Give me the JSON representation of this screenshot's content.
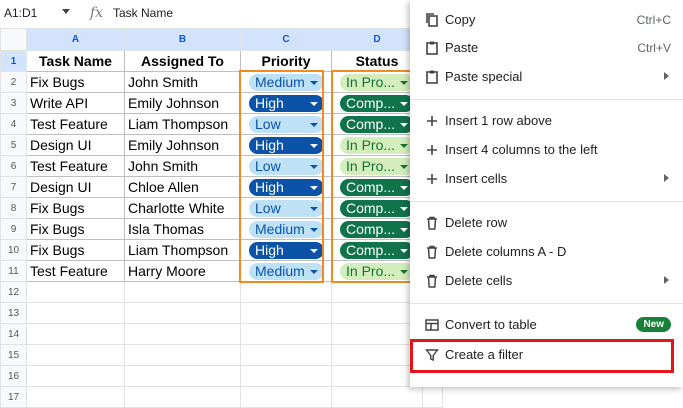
{
  "formula_bar": {
    "name_box": "A1:D1",
    "fx": "fx",
    "content": "Task Name"
  },
  "columns": [
    "A",
    "B",
    "C",
    "D"
  ],
  "row_numbers": [
    "1",
    "2",
    "3",
    "4",
    "5",
    "6",
    "7",
    "8",
    "9",
    "10",
    "11",
    "12",
    "13",
    "14",
    "15",
    "16",
    "17"
  ],
  "headers": [
    "Task Name",
    "Assigned To",
    "Priority",
    "Status"
  ],
  "rows": [
    {
      "task": "Fix Bugs",
      "assigned": "John Smith",
      "priority": "Medium",
      "status": "In Pro..."
    },
    {
      "task": "Write API",
      "assigned": "Emily Johnson",
      "priority": "High",
      "status": "Comp..."
    },
    {
      "task": "Test Feature",
      "assigned": "Liam Thompson",
      "priority": "Low",
      "status": "Comp..."
    },
    {
      "task": "Design UI",
      "assigned": "Emily Johnson",
      "priority": "High",
      "status": "In Pro..."
    },
    {
      "task": "Test Feature",
      "assigned": "John Smith",
      "priority": "Low",
      "status": "In Pro..."
    },
    {
      "task": "Design UI",
      "assigned": "Chloe Allen",
      "priority": "High",
      "status": "Comp..."
    },
    {
      "task": "Fix Bugs",
      "assigned": "Charlotte White",
      "priority": "Low",
      "status": "Comp..."
    },
    {
      "task": "Fix Bugs",
      "assigned": "Isla Thomas",
      "priority": "Medium",
      "status": "Comp..."
    },
    {
      "task": "Fix Bugs",
      "assigned": "Liam Thompson",
      "priority": "High",
      "status": "Comp..."
    },
    {
      "task": "Test Feature",
      "assigned": "Harry Moore",
      "priority": "Medium",
      "status": "In Pro..."
    }
  ],
  "context_menu": {
    "items": [
      {
        "label": "Copy",
        "shortcut": "Ctrl+C",
        "icon": "copy-icon"
      },
      {
        "label": "Paste",
        "shortcut": "Ctrl+V",
        "icon": "paste-icon"
      },
      {
        "label": "Paste special",
        "icon": "paste-special-icon"
      },
      {
        "label": "Insert 1 row above",
        "icon": "plus-icon"
      },
      {
        "label": "Insert 4 columns to the left",
        "icon": "plus-icon"
      },
      {
        "label": "Insert cells",
        "icon": "plus-icon"
      },
      {
        "label": "Delete row",
        "icon": "trash-icon"
      },
      {
        "label": "Delete columns A - D",
        "icon": "trash-icon"
      },
      {
        "label": "Delete cells",
        "icon": "trash-icon"
      },
      {
        "label": "Convert to table",
        "badge": "New",
        "icon": "table-icon"
      },
      {
        "label": "Create a filter",
        "icon": "filter-icon"
      }
    ]
  },
  "colors": {
    "chip_medium_bg": "#bfe1f6",
    "chip_high_bg": "#0a53a8",
    "chip_inprogress_bg": "#d4edbc",
    "chip_completed_bg": "#11734b",
    "highlight_border": "#e3151b",
    "column_outline": "#f08a24",
    "new_badge": "#188038"
  }
}
